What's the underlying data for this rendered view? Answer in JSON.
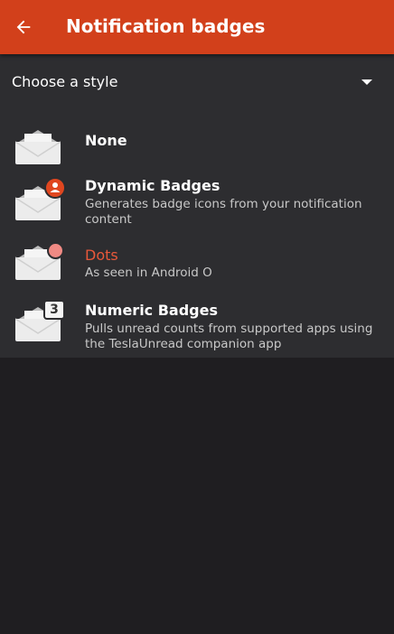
{
  "app_bar": {
    "title": "Notification badges",
    "back_icon": "arrow-back-icon",
    "color": "#d2401b"
  },
  "style_selector": {
    "label": "Choose a style",
    "arrow_icon": "dropdown-arrow-icon"
  },
  "options": [
    {
      "title": "None",
      "description": "",
      "icon": "envelope-icon",
      "selected": false
    },
    {
      "title": "Dynamic Badges",
      "description": "Generates badge icons from your notification content",
      "icon": "envelope-person-badge-icon",
      "selected": false
    },
    {
      "title": "Dots",
      "description": "As seen in Android O",
      "icon": "envelope-dot-badge-icon",
      "selected": true
    },
    {
      "title": "Numeric Badges",
      "description": "Pulls unread counts from supported apps using the TeslaUnread companion app",
      "icon": "envelope-number-badge-icon",
      "badge_count": "3",
      "selected": false
    }
  ],
  "colors": {
    "accent": "#e8583a",
    "panel": "#2d2d30",
    "background": "#1f1e21"
  }
}
